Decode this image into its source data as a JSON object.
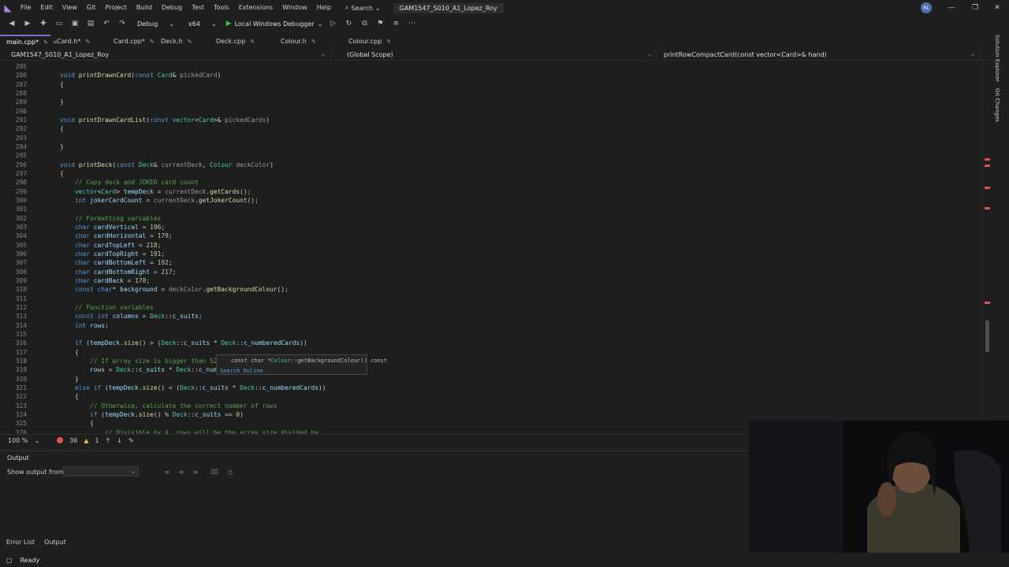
{
  "menu": {
    "items": [
      "File",
      "Edit",
      "View",
      "Git",
      "Project",
      "Build",
      "Debug",
      "Test",
      "Tools",
      "Extensions",
      "Window",
      "Help"
    ],
    "search_label": "Search",
    "solution_name": "GAM1547_S010_A1_Lopez_Roy",
    "avatar": "RL"
  },
  "toolbar": {
    "config": "Debug",
    "platform": "x64",
    "run_label": "Local Windows Debugger"
  },
  "tabs": [
    {
      "label": "main.cpp*",
      "active": true
    },
    {
      "label": "Card.h*",
      "active": false
    },
    {
      "label": "Card.cpp*",
      "active": false
    },
    {
      "label": "Deck.h",
      "active": false
    },
    {
      "label": "Deck.cpp",
      "active": false
    },
    {
      "label": "Colour.h",
      "active": false
    },
    {
      "label": "Colour.cpp",
      "active": false
    }
  ],
  "navbar": {
    "project": "GAM1547_S010_A1_Lopez_Roy",
    "scope": "(Global Scope)",
    "member": "printRowCompactCard(const vector<Card>& hand)"
  },
  "editor": {
    "line_numbers": [
      "285",
      "286",
      "287",
      "288",
      "289",
      "290",
      "291",
      "292",
      "293",
      "294",
      "295",
      "296",
      "297",
      "298",
      "299",
      "300",
      "301",
      "302",
      "303",
      "304",
      "305",
      "306",
      "307",
      "308",
      "309",
      "310",
      "311",
      "312",
      "313",
      "314",
      "315",
      "316",
      "317",
      "318",
      "319",
      "320",
      "321",
      "322",
      "323",
      "324",
      "325",
      "326"
    ]
  },
  "tooltip": {
    "signature_pre": "const char *",
    "signature_type": "Colour",
    "signature_post": "::getBackgroundColour() const",
    "search": "Search Online"
  },
  "editor_status": {
    "zoom": "100 %",
    "errors": "36",
    "warnings": "1"
  },
  "output": {
    "title": "Output",
    "show_from_label": "Show output from:",
    "show_from_value": ""
  },
  "bottom_tabs": [
    "Error List",
    "Output"
  ],
  "status": {
    "text": "Ready"
  },
  "right_tabs": [
    "Solution Explorer",
    "Git Changes"
  ]
}
